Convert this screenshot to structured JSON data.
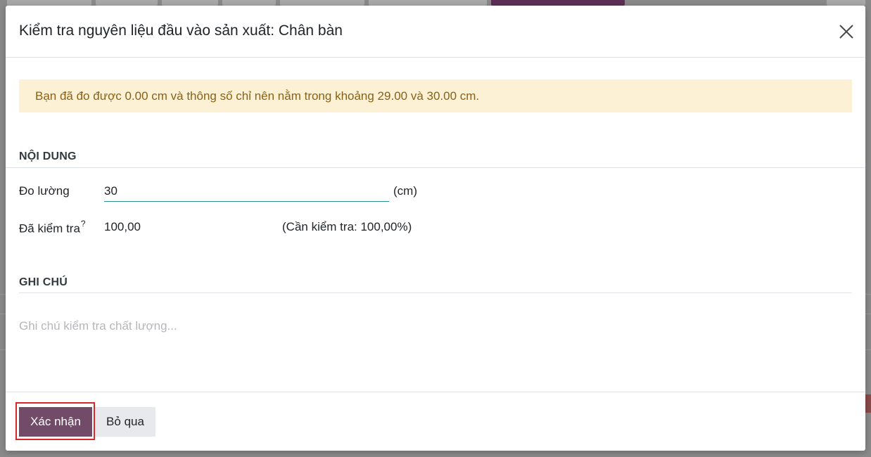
{
  "dialog": {
    "title": "Kiểm tra nguyên liệu đầu vào sản xuất: Chân bàn"
  },
  "alert": {
    "message": "Bạn đã đo được 0.00 cm và thông số chỉ nên nằm trong khoảng 29.00 và 30.00 cm."
  },
  "content_section": {
    "title": "NỘI DUNG",
    "measure": {
      "label": "Đo lường",
      "value": "30",
      "unit": "(cm)"
    },
    "tested": {
      "label": "Đã kiểm tra",
      "help_marker": "?",
      "value": "100,00",
      "required": "(Cần kiểm tra: 100,00%)"
    }
  },
  "notes_section": {
    "title": "GHI CHÚ",
    "placeholder": "Ghi chú kiểm tra chất lượng..."
  },
  "footer": {
    "confirm_label": "Xác nhận",
    "discard_label": "Bỏ qua"
  },
  "colors": {
    "primary": "#714b67",
    "alert_bg": "#fcf1d4",
    "alert_text": "#8a6116",
    "focus_ring": "#d9262b",
    "input_underline": "#2d8f9e"
  },
  "icons": {
    "close": "close-icon"
  }
}
